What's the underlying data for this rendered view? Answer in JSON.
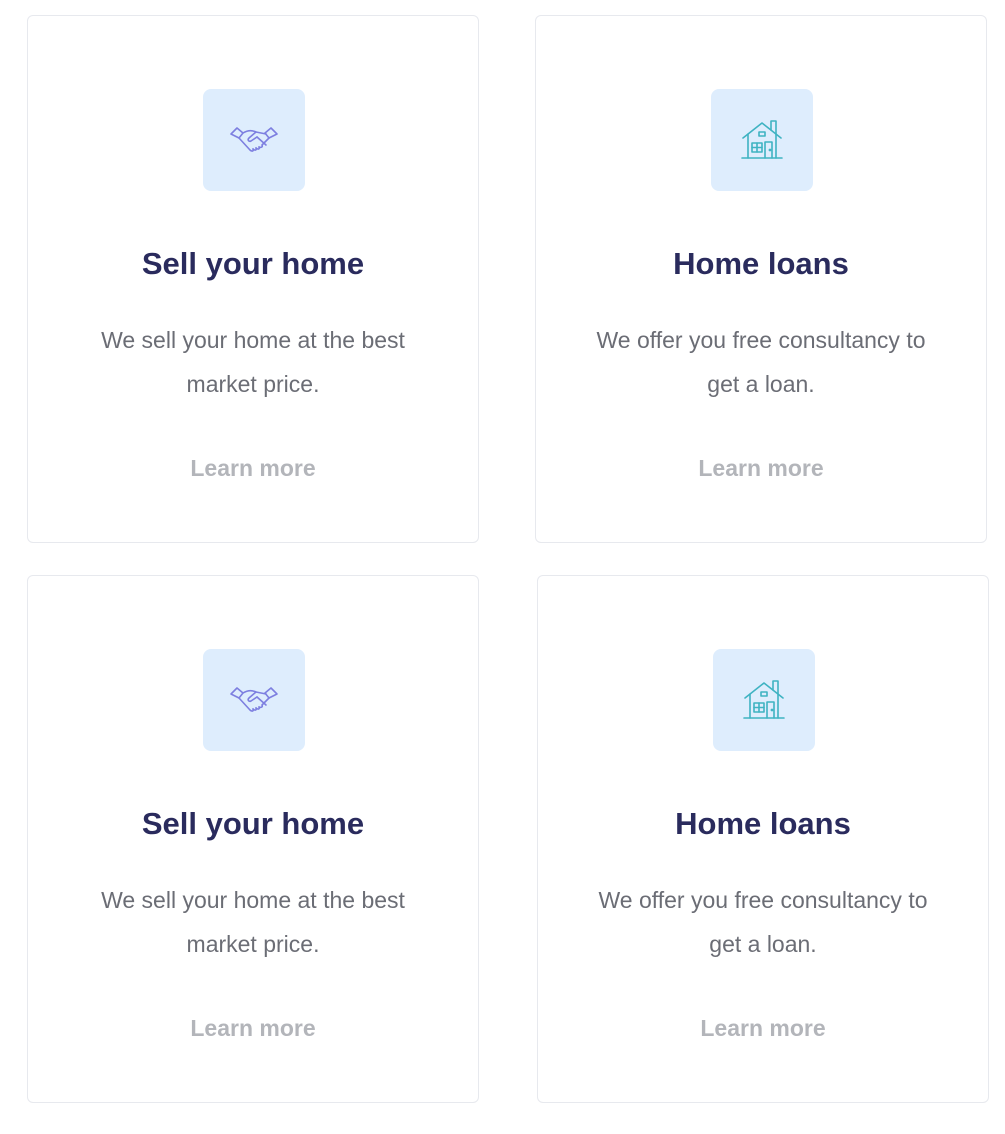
{
  "cards": [
    {
      "icon": "handshake-icon",
      "title": "Sell your home",
      "description": "We sell your home at the best market price.",
      "link": "Learn more"
    },
    {
      "icon": "house-icon",
      "title": "Home loans",
      "description": "We offer you free consultancy to get a loan.",
      "link": "Learn more"
    },
    {
      "icon": "handshake-icon",
      "title": "Sell your home",
      "description": "We sell your home at the best market price.",
      "link": "Learn more"
    },
    {
      "icon": "house-icon",
      "title": "Home loans",
      "description": "We offer you free consultancy to get a loan.",
      "link": "Learn more"
    }
  ],
  "colors": {
    "title": "#2a2b5d",
    "body": "#6b6d75",
    "link": "#b3b5ba",
    "icon_tile": "#deedfd",
    "handshake_stroke": "#7d7fe0",
    "house_stroke": "#3fb3c2"
  }
}
